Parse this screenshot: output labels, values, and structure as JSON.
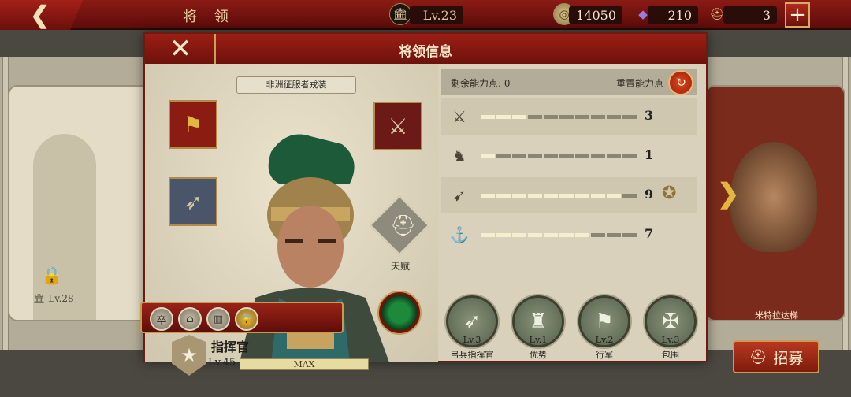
{
  "topbar": {
    "title": "将 领",
    "city_level": "Lv.23",
    "coins": "14050",
    "gems": "210",
    "troops": "3",
    "add_label": "+"
  },
  "background": {
    "left_card_level": "Lv.28",
    "right_hero_name": "米特拉达梯"
  },
  "modal": {
    "title": "将领信息",
    "skin_label": "非洲征服者戎装",
    "talent_label": "天赋",
    "rank": "指挥官",
    "level": "Lv.45",
    "level_bar": "MAX",
    "remaining_points_label": "剩余能力点: 0",
    "reset_label": "重置能力点",
    "stats": [
      {
        "icon": "sword-icon",
        "value": "3",
        "filled": 3
      },
      {
        "icon": "horse-icon",
        "value": "1",
        "filled": 1
      },
      {
        "icon": "bow-icon",
        "value": "9",
        "filled": 9
      },
      {
        "icon": "anchor-icon",
        "value": "7",
        "filled": 7
      }
    ],
    "skills": [
      {
        "level": "Lv.3",
        "name": "弓兵指挥官"
      },
      {
        "level": "Lv.1",
        "name": "优势"
      },
      {
        "level": "Lv.2",
        "name": "行军"
      },
      {
        "level": "Lv.3",
        "name": "包围"
      }
    ]
  },
  "recruit_label": "招募",
  "colors": {
    "accent_red": "#8a1a14",
    "gold": "#c9a25a"
  }
}
